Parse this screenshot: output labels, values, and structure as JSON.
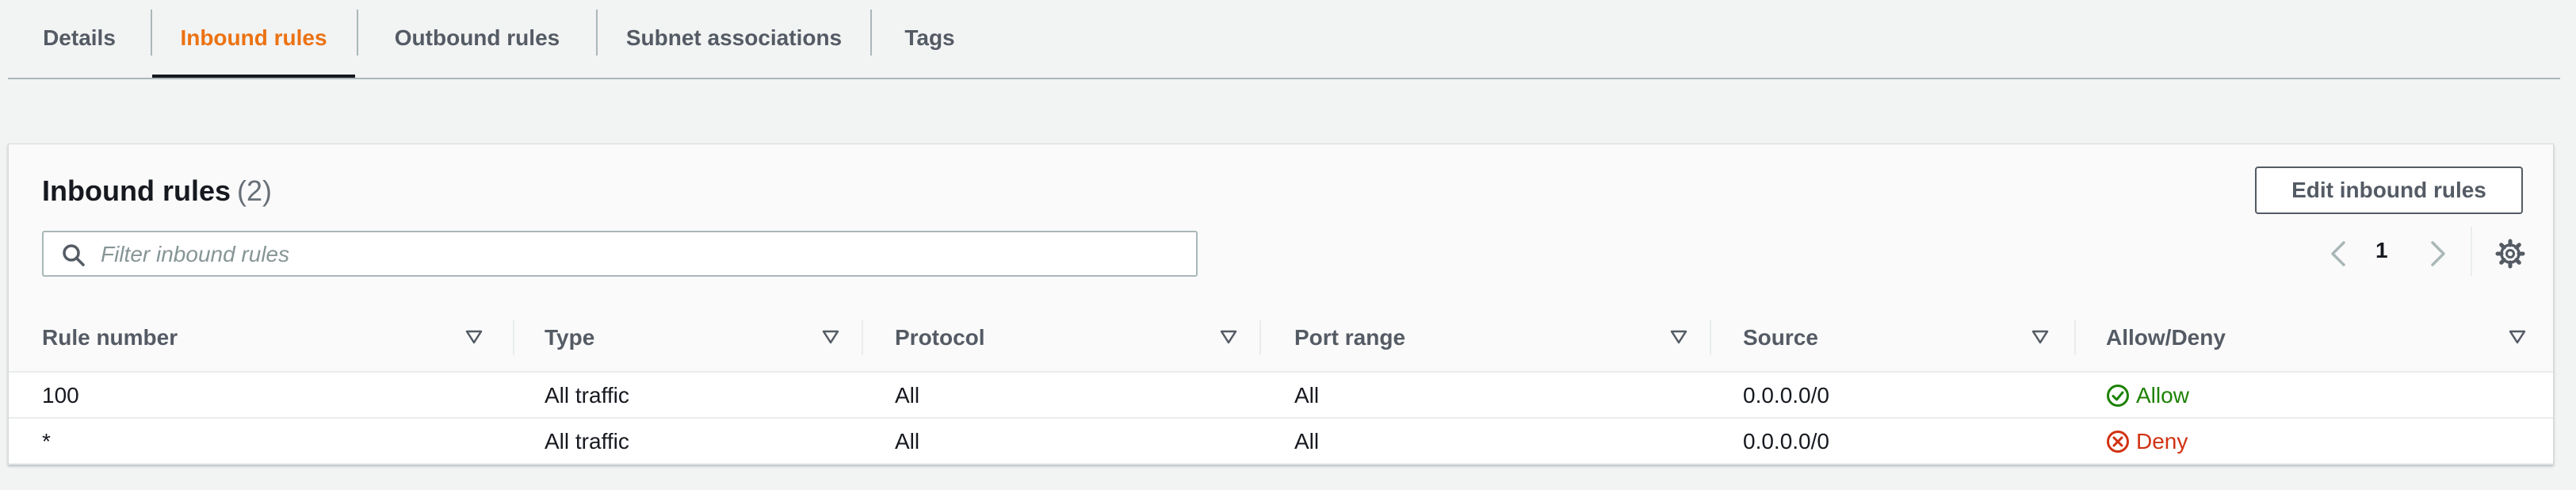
{
  "tabs": [
    {
      "label": "Details"
    },
    {
      "label": "Inbound rules",
      "active": true
    },
    {
      "label": "Outbound rules"
    },
    {
      "label": "Subnet associations"
    },
    {
      "label": "Tags"
    }
  ],
  "panel": {
    "title": "Inbound rules",
    "count": "(2)",
    "edit_button": "Edit inbound rules",
    "search_placeholder": "Filter inbound rules",
    "current_page": "1"
  },
  "table": {
    "columns": [
      "Rule number",
      "Type",
      "Protocol",
      "Port range",
      "Source",
      "Allow/Deny"
    ],
    "rows": [
      {
        "rule_number": "100",
        "type": "All traffic",
        "protocol": "All",
        "port_range": "All",
        "source": "0.0.0.0/0",
        "action": "Allow"
      },
      {
        "rule_number": "*",
        "type": "All traffic",
        "protocol": "All",
        "port_range": "All",
        "source": "0.0.0.0/0",
        "action": "Deny"
      }
    ]
  },
  "colors": {
    "active_tab": "#ec7211",
    "allow": "#1d8102",
    "deny": "#d13212"
  },
  "icons": [
    "search-icon",
    "chevron-left-icon",
    "chevron-right-icon",
    "settings-gear-icon",
    "sort-triangle-icon",
    "check-circle-icon",
    "x-circle-icon"
  ]
}
